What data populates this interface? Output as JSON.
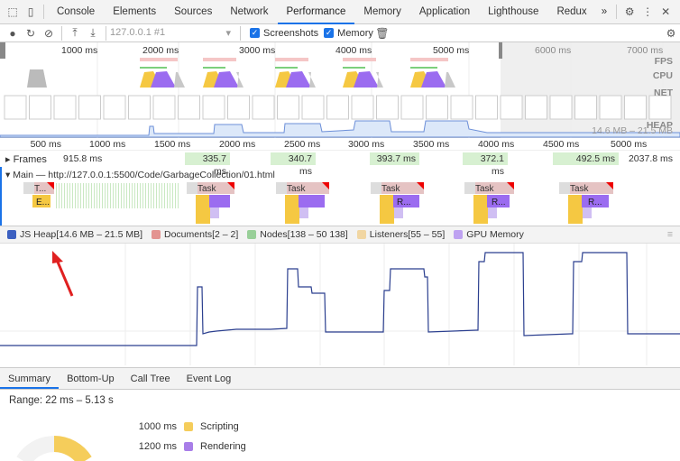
{
  "tabs": [
    "Console",
    "Elements",
    "Sources",
    "Network",
    "Performance",
    "Memory",
    "Application",
    "Lighthouse",
    "Redux"
  ],
  "active_tab": "Performance",
  "more_tabs": "»",
  "toolbar": {
    "profile_select": "127.0.0.1 #1",
    "screenshots_label": "Screenshots",
    "screenshots_checked": true,
    "memory_label": "Memory",
    "memory_checked": true
  },
  "overview": {
    "ticks": [
      "1000 ms",
      "2000 ms",
      "3000 ms",
      "4000 ms",
      "5000 ms",
      "6000 ms",
      "7000 ms"
    ],
    "tracks": [
      "FPS",
      "CPU",
      "NET",
      "HEAP"
    ],
    "heap_range": "14.6 MB – 21.5 MB"
  },
  "ruler": [
    "500 ms",
    "1000 ms",
    "1500 ms",
    "2000 ms",
    "2500 ms",
    "3000 ms",
    "3500 ms",
    "4000 ms",
    "4500 ms",
    "5000 ms"
  ],
  "frames": {
    "label": "Frames",
    "items": [
      "915.8 ms",
      "335.7 ms",
      "340.7 ms",
      "393.7 ms",
      "372.1 ms",
      "492.5 ms",
      "2037.8 ms"
    ]
  },
  "main": {
    "label": "Main — http://127.0.0.1:5500/Code/GarbageCollection/01.html",
    "tasks": [
      "T...",
      "Task",
      "Task",
      "Task",
      "Task",
      "Task"
    ],
    "subs": [
      "E...",
      "R...",
      "R...",
      "R..."
    ]
  },
  "legend": [
    {
      "label": "JS Heap[14.6 MB – 21.5 MB]",
      "color": "#3b5fc0",
      "checked": true
    },
    {
      "label": "Documents[2 – 2]",
      "color": "#d9534f",
      "checked": false
    },
    {
      "label": "Nodes[138 – 50 138]",
      "color": "#5cb85c",
      "checked": false
    },
    {
      "label": "Listeners[55 – 55]",
      "color": "#f0c36d",
      "checked": false
    },
    {
      "label": "GPU Memory",
      "color": "#9b6cf0",
      "checked": false
    }
  ],
  "bottom_tabs": [
    "Summary",
    "Bottom-Up",
    "Call Tree",
    "Event Log"
  ],
  "summary": {
    "range": "Range: 22 ms – 5.13 s",
    "rows": [
      {
        "time": "1000 ms",
        "label": "Scripting",
        "color": "#f5cd5b"
      },
      {
        "time": "1200 ms",
        "label": "Rendering",
        "color": "#a87ee8"
      }
    ]
  },
  "colors": {
    "accent": "#1a73e8",
    "scripting": "#f5c842",
    "rendering": "#9b6cf0",
    "heap_line": "#2b3f8f"
  }
}
